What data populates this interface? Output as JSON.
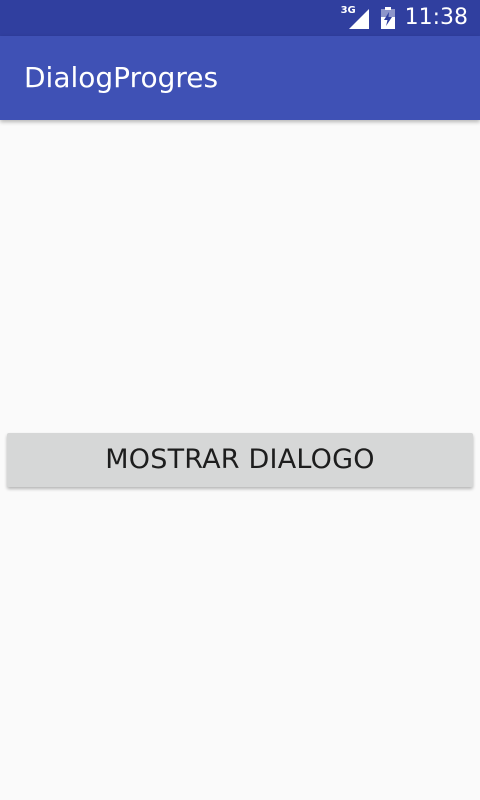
{
  "status_bar": {
    "network": "3G",
    "time": "11:38"
  },
  "app_bar": {
    "title": "DialogProgres"
  },
  "main": {
    "button_label": "MOSTRAR DIALOGO"
  },
  "colors": {
    "status_bar": "#303f9f",
    "app_bar": "#3f51b5",
    "background": "#fafafa",
    "button": "#d6d7d7"
  }
}
